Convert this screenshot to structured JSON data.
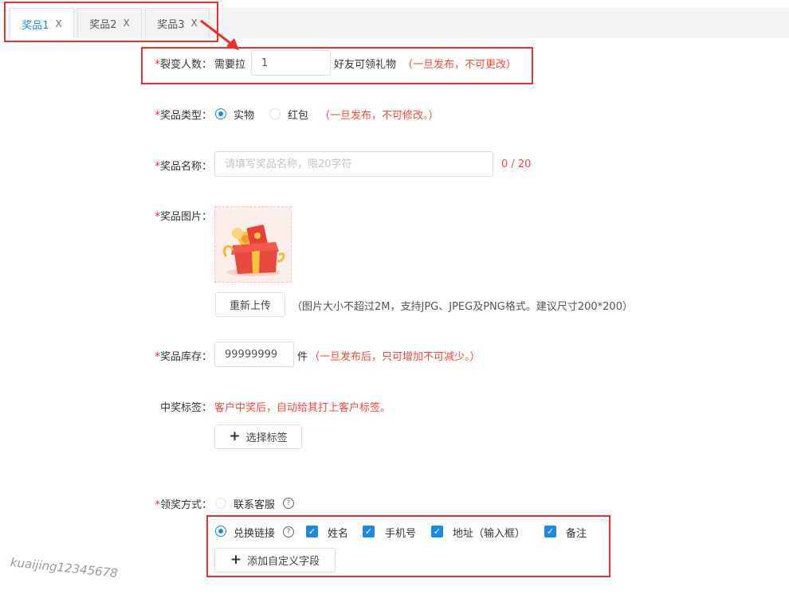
{
  "tabs": [
    {
      "label": "奖品1",
      "close": "X"
    },
    {
      "label": "奖品2",
      "close": "X"
    },
    {
      "label": "奖品3",
      "close": "X"
    }
  ],
  "fission": {
    "label": "裂变人数：",
    "prefix": "需要拉",
    "value": "1",
    "suffix": "好友可领礼物",
    "note": "（一旦发布，不可更改）"
  },
  "prize_type": {
    "label": "奖品类型：",
    "options": [
      "实物",
      "红包"
    ],
    "note": "（一旦发布，不可修改。）"
  },
  "prize_name": {
    "label": "奖品名称：",
    "placeholder": "请填写奖品名称，限20字符",
    "counter": "0 / 20"
  },
  "prize_image": {
    "label": "奖品图片：",
    "reupload": "重新上传",
    "hint": "（图片大小不超过2M，支持JPG、JPEG及PNG格式。建议尺寸200*200）"
  },
  "stock": {
    "label": "奖品库存：",
    "value": "99999999",
    "unit": "件",
    "note": "（一旦发布后，只可增加不可减少。）"
  },
  "win_tag": {
    "label": "中奖标签：",
    "desc": "客户中奖后，自动给其打上客户标签。",
    "button": "选择标签"
  },
  "claim": {
    "label": "领奖方式：",
    "opt_service": "联系客服",
    "opt_link": "兑换链接",
    "fields": [
      "姓名",
      "手机号",
      "地址（输入框）",
      "备注"
    ],
    "add_button": "添加自定义字段"
  },
  "required_mark": "*",
  "help_glyph": "?",
  "check_glyph": "✓",
  "plus_glyph": "+",
  "watermark": "kuaijing12345678",
  "colors": {
    "accent": "#1e88e5",
    "warning": "#f5483b",
    "highlight": "#ea2f2f"
  }
}
